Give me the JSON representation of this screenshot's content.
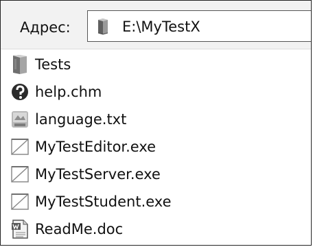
{
  "address_bar": {
    "label": "Адрес:",
    "value": "E:\\MyTestX",
    "icon": "folder-icon"
  },
  "files": [
    {
      "name": "Tests",
      "icon": "folder-icon"
    },
    {
      "name": "help.chm",
      "icon": "help-file-icon"
    },
    {
      "name": "language.txt",
      "icon": "text-file-icon"
    },
    {
      "name": "MyTestEditor.exe",
      "icon": "executable-icon"
    },
    {
      "name": "MyTestServer.exe",
      "icon": "executable-icon"
    },
    {
      "name": "MyTestStudent.exe",
      "icon": "executable-icon"
    },
    {
      "name": "ReadMe.doc",
      "icon": "word-document-icon"
    }
  ],
  "colors": {
    "window_background": "#f6f6f6",
    "list_background": "#ffffff",
    "text": "#111111",
    "border": "#222222"
  }
}
